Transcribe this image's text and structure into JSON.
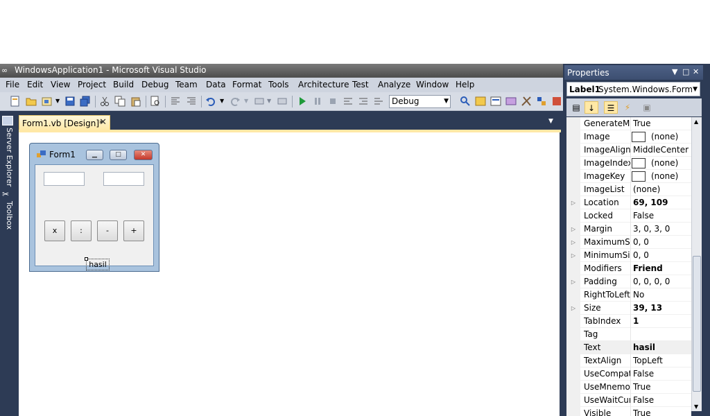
{
  "window": {
    "title": "WindowsApplication1 - Microsoft Visual Studio"
  },
  "menu": [
    "File",
    "Edit",
    "View",
    "Project",
    "Build",
    "Debug",
    "Team",
    "Data",
    "Format",
    "Tools",
    "Architecture",
    "Test",
    "Analyze",
    "Window",
    "Help"
  ],
  "toolbar": {
    "config": "Debug"
  },
  "side": {
    "server_explorer": "Server Explorer",
    "toolbox": "Toolbox"
  },
  "doc_tab": {
    "label": "Form1.vb [Design]*",
    "close": "✕"
  },
  "form": {
    "title": "Form1",
    "buttons": [
      "x",
      ":",
      "-",
      "+"
    ],
    "label": "hasil"
  },
  "properties": {
    "title": "Properties",
    "object_name": "Label1",
    "object_type": "System.Windows.Forms.L",
    "rows": [
      {
        "name": "GenerateMem",
        "value": "True",
        "bold": false,
        "expand": false,
        "swatch": false
      },
      {
        "name": "Image",
        "value": "(none)",
        "bold": false,
        "expand": false,
        "swatch": true
      },
      {
        "name": "ImageAlign",
        "value": "MiddleCenter",
        "bold": false,
        "expand": false,
        "swatch": false
      },
      {
        "name": "ImageIndex",
        "value": "(none)",
        "bold": false,
        "expand": false,
        "swatch": true
      },
      {
        "name": "ImageKey",
        "value": "(none)",
        "bold": false,
        "expand": false,
        "swatch": true
      },
      {
        "name": "ImageList",
        "value": "(none)",
        "bold": false,
        "expand": false,
        "swatch": false
      },
      {
        "name": "Location",
        "value": "69, 109",
        "bold": true,
        "expand": true,
        "swatch": false
      },
      {
        "name": "Locked",
        "value": "False",
        "bold": false,
        "expand": false,
        "swatch": false
      },
      {
        "name": "Margin",
        "value": "3, 0, 3, 0",
        "bold": false,
        "expand": true,
        "swatch": false
      },
      {
        "name": "MaximumSiz",
        "value": "0, 0",
        "bold": false,
        "expand": true,
        "swatch": false
      },
      {
        "name": "MinimumSiz",
        "value": "0, 0",
        "bold": false,
        "expand": true,
        "swatch": false
      },
      {
        "name": "Modifiers",
        "value": "Friend",
        "bold": true,
        "expand": false,
        "swatch": false
      },
      {
        "name": "Padding",
        "value": "0, 0, 0, 0",
        "bold": false,
        "expand": true,
        "swatch": false
      },
      {
        "name": "RightToLeft",
        "value": "No",
        "bold": false,
        "expand": false,
        "swatch": false
      },
      {
        "name": "Size",
        "value": "39, 13",
        "bold": true,
        "expand": true,
        "swatch": false
      },
      {
        "name": "TabIndex",
        "value": "1",
        "bold": true,
        "expand": false,
        "swatch": false
      },
      {
        "name": "Tag",
        "value": "",
        "bold": false,
        "expand": false,
        "swatch": false
      },
      {
        "name": "Text",
        "value": "hasil",
        "bold": true,
        "expand": false,
        "swatch": false,
        "selected": true
      },
      {
        "name": "TextAlign",
        "value": "TopLeft",
        "bold": false,
        "expand": false,
        "swatch": false
      },
      {
        "name": "UseCompati",
        "value": "False",
        "bold": false,
        "expand": false,
        "swatch": false
      },
      {
        "name": "UseMnemor",
        "value": "True",
        "bold": false,
        "expand": false,
        "swatch": false
      },
      {
        "name": "UseWaitCurs",
        "value": "False",
        "bold": false,
        "expand": false,
        "swatch": false
      },
      {
        "name": "Visible",
        "value": "True",
        "bold": false,
        "expand": false,
        "swatch": false
      }
    ]
  }
}
